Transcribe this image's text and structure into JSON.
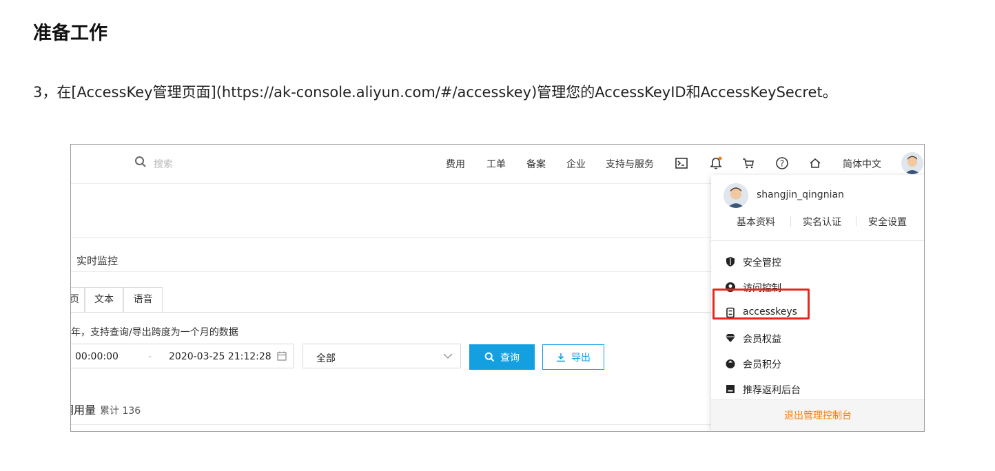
{
  "doc": {
    "heading": "准备工作",
    "paragraph": "3，在[AccessKey管理页面](https://ak-console.aliyun.com/#/accesskey)管理您的AccessKeyID和AccessKeySecret。"
  },
  "screenshot": {
    "search": {
      "placeholder": "搜索",
      "icon": "search-icon"
    },
    "nav": [
      "费用",
      "工单",
      "备案",
      "企业",
      "支持与服务"
    ],
    "nav_icons": [
      "terminal-icon",
      "bell-icon",
      "cart-icon",
      "help-icon",
      "home-icon"
    ],
    "language": "简体中文",
    "section_tab": "实时监控",
    "tabs": [
      "页",
      "文本",
      "语音"
    ],
    "hint": "年，支持查询/导出跨度为一个月的数据",
    "date_start": "00:00:00",
    "date_sep": "-",
    "date_end": "2020-03-25 21:12:28",
    "select_value": "全部",
    "query_label": "查询",
    "export_label": "导出",
    "usage_title": "调用量",
    "usage_total": "累计 136",
    "colors": {
      "primary": "#14a0e0",
      "highlight": "#e8261f",
      "logout": "#ff7a00"
    }
  },
  "user_menu": {
    "username": "shangjin_qingnian",
    "profile_links": [
      "基本资料",
      "实名认证",
      "安全设置"
    ],
    "items": [
      {
        "label": "安全管控",
        "icon": "shield-icon"
      },
      {
        "label": "访问控制",
        "icon": "user-circle-icon"
      },
      {
        "label": "accesskeys",
        "icon": "key-icon",
        "highlighted": true
      },
      {
        "label": "会员权益",
        "icon": "diamond-icon"
      },
      {
        "label": "会员积分",
        "icon": "points-icon"
      },
      {
        "label": "推荐返利后台",
        "icon": "rebate-icon"
      }
    ],
    "logout": "退出管理控制台"
  }
}
